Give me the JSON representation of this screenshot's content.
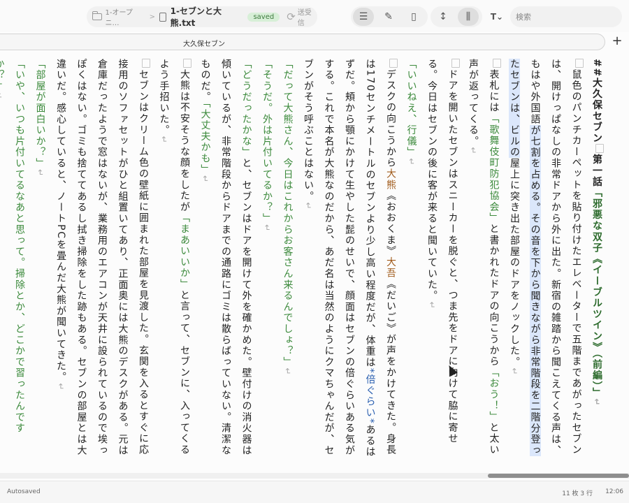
{
  "toolbar": {
    "breadcrumb_folder": "1-オープニ…",
    "breadcrumb_sep": ">",
    "file_name": "1-セブンと大熊.txt",
    "saved_label": "saved",
    "sync_label": "送受信",
    "t_label": "T⌄",
    "search_placeholder": "検索",
    "icons": [
      "folder-icon",
      "document-icon",
      "sync-icon",
      "align-icon",
      "edit-icon",
      "page-icon",
      "line-spacing-icon",
      "vertical-columns-icon",
      "font-icon"
    ]
  },
  "tab": {
    "title": "大久保セブン",
    "plus": "+"
  },
  "editor": {
    "return_glyph": "↵",
    "heading": {
      "hash": "##",
      "name": "大久保セブン",
      "chapter": "第一話",
      "bracket_open": "「",
      "title": "邪悪な双子《イーブルツイン》（前編）",
      "bracket_close": "」"
    },
    "p1": {
      "a": "鼠色のパンチカーペットを貼り付けたエレベーターで五階まであがったセブンは、開けっぱなしの非常ドアから外に出た。新宿の雑踏から聞こえてくる声は、もはや外国語",
      "hl": "が七割を占める。その音を下から聞きながら非常階段を二階分登ったセブンは、ビルの",
      "b": "屋上に突き出た部屋のドアをノックした。"
    },
    "p2": {
      "a": "表札には",
      "q": "「歌舞伎町防犯協会」",
      "b": "と書かれたドアの向こうから",
      "q2": "「おう！」",
      "c": "と太い声が返ってくる。"
    },
    "p3": "ドアを開いたセブンはスニーカーを脱ぐと、つま先をドアに向けて脇に寄せる。今日はセブンの後に客が来ると聞いていた。",
    "p4": "「いいねえ、行儀」",
    "p5": {
      "a": "デスクの向こうから",
      "name": "大熊",
      "r1": "《おおくま》",
      "name2": "大吾",
      "r2": "《だいご》",
      "b": "が声をかけてきた。身長は170センチメートルのセブンより少し高い程度だが、体重は",
      "emph": "*倍ぐらい*",
      "c": "あるはずだ。頬から顎にかけて生やした髭のせいで、顔面はセブンの倍ぐらいある気がする。これで本名が大熊なのだから、あだ名は当然のようにクマちゃんだが、セブンがそう呼ぶことはない。"
    },
    "p6": "「だって大熊さん、今日はこれからお客さん来るんでしょ？」",
    "p7": "「そうだ。外は片付いてるか？」",
    "p8": {
      "q": "「どうだったかな」",
      "a": "と、セブンはドアを開けて外を確かめた。壁付けの消火器は傾いているが、非常階段からドアまでの通路にゴミは散らばっていない。清潔なものだ。",
      "q2": "「大丈夫かも」"
    },
    "p9": {
      "a": "大熊は不安そうな顔をしたが",
      "q": "「まあいいか」",
      "b": "と言って、セブンに、入ってくるよう手招いた。"
    },
    "p10": "セブンはクリーム色の壁紙に囲まれた部屋を見渡した。玄関を入るとすぐに応接用のソファセットがひと組置いてあり、正面奥には大熊のデスクがある。元は倉庫だったようで窓はないが、業務用のエアコンが天井に設られているので埃っぽくはない。ゴミも捨ててあるし拭き掃除をした跡もある。セブンの部屋とは大違いだ。感心していると、ノートPCを畳んだ大熊が聞いてきた。",
    "p11": "「部屋が面白いか？」",
    "p12": "「いや、いつも片付いてるなあと思って。掃除とか、どこかで習ったんですか？」"
  },
  "status": {
    "autosave": "Autosaved",
    "position": "11 枚 3 行",
    "time": "12:06"
  }
}
